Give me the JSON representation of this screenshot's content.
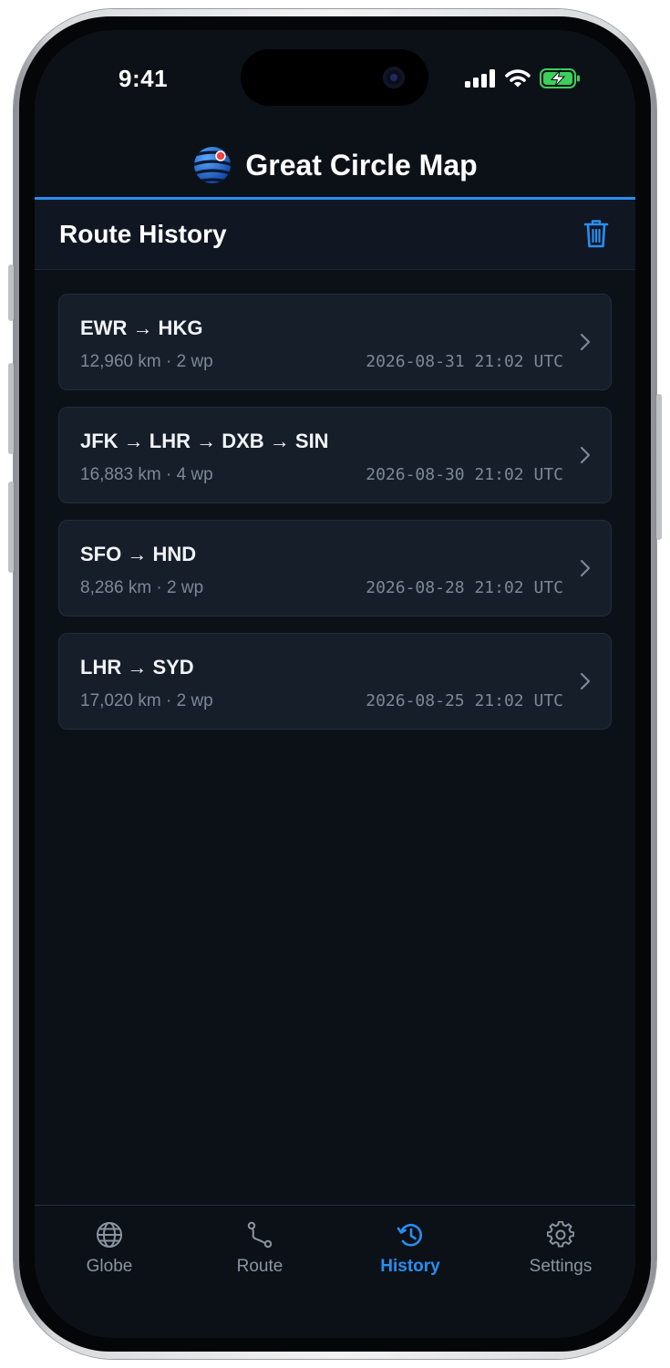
{
  "status_bar": {
    "time": "9:41"
  },
  "header": {
    "app_title": "Great Circle Map"
  },
  "section": {
    "title": "Route History"
  },
  "routes": [
    {
      "name": "EWR → HKG",
      "meta": "12,960 km · 2 wp",
      "date": "2026-08-31 21:02 UTC"
    },
    {
      "name": "JFK → LHR → DXB → SIN",
      "meta": "16,883 km · 4 wp",
      "date": "2026-08-30 21:02 UTC"
    },
    {
      "name": "SFO → HND",
      "meta": "8,286 km · 2 wp",
      "date": "2026-08-28 21:02 UTC"
    },
    {
      "name": "LHR → SYD",
      "meta": "17,020 km · 2 wp",
      "date": "2026-08-25 21:02 UTC"
    }
  ],
  "tab_bar": {
    "tabs": [
      {
        "label": "Globe",
        "icon": "globe-icon"
      },
      {
        "label": "Route",
        "icon": "route-icon"
      },
      {
        "label": "History",
        "icon": "history-icon",
        "active": true
      },
      {
        "label": "Settings",
        "icon": "gear-icon"
      }
    ]
  },
  "colors": {
    "accent": "#2a8ef0",
    "background": "#0c1118",
    "card": "#161e2a",
    "muted_text": "#7d8896",
    "battery_green": "#3ccf5a"
  }
}
